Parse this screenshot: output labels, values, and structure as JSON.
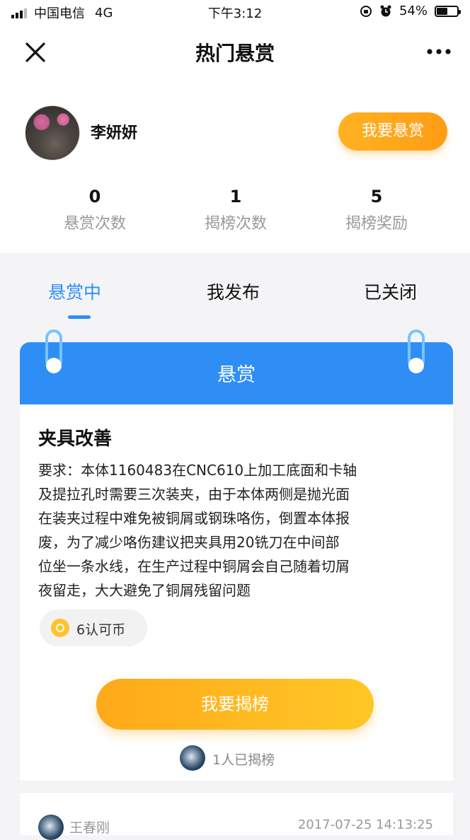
{
  "status_bar": {
    "carrier": "中国电信",
    "network": "4G",
    "time": "下午3:12",
    "battery": "54%",
    "battery_level": 0.54
  },
  "nav": {
    "title": "热门悬赏",
    "close_icon": "close-icon",
    "more_icon": "more-icon"
  },
  "profile": {
    "name": "李妍妍",
    "reward_button": "我要悬赏",
    "stats": [
      {
        "value": "0",
        "label": "悬赏次数"
      },
      {
        "value": "1",
        "label": "揭榜次数"
      },
      {
        "value": "5",
        "label": "揭榜奖励"
      }
    ]
  },
  "tabs": [
    {
      "label": "悬赏中",
      "active": true
    },
    {
      "label": "我发布",
      "active": false
    },
    {
      "label": "已关闭",
      "active": false
    }
  ],
  "card": {
    "header": "悬赏",
    "title": "夹具改善",
    "description_lines": [
      "要求：本体1160483在CNC610上加工底面和卡轴",
      "及提拉孔时需要三次装夹，由于本体两侧是抛光面",
      "在装夹过程中难免被铜屑或钢珠咯伤，倒置本体报",
      "废，为了减少咯伤建议把夹具用20铣刀在中间部",
      "位坐一条水线，在生产过程中铜屑会自己随着切屑",
      "夜留走，大大避免了铜屑残留问题"
    ],
    "coin": "6认可币",
    "action_button": "我要揭榜",
    "taken_count": "1人已揭榜"
  },
  "bottom_item": {
    "name": "王春刚",
    "date": "2017-07-25 14:13:25"
  },
  "colors": {
    "accent_blue": "#2e8ef6",
    "accent_orange": "#ffa919"
  }
}
